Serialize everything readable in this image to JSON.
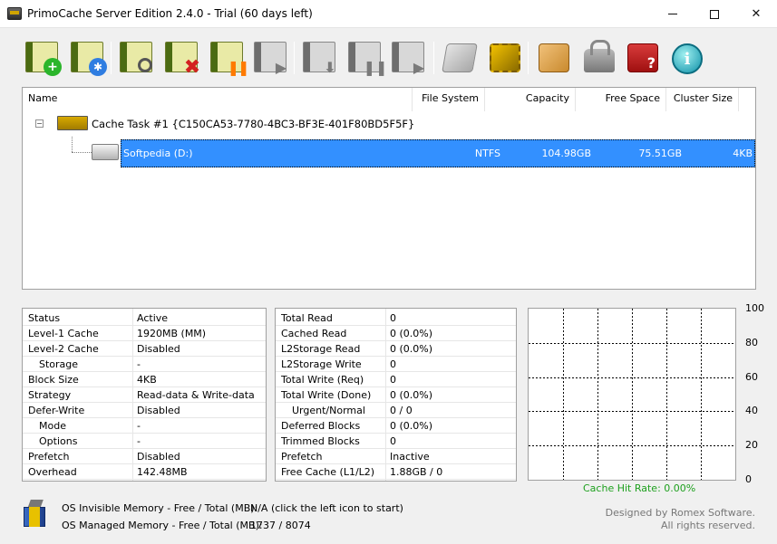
{
  "window": {
    "title": "PrimoCache Server Edition 2.4.0 - Trial (60 days left)",
    "minimize_label": "minimize",
    "maximize_label": "maximize",
    "close_label": "✕"
  },
  "toolbar": {
    "buttons": [
      {
        "name": "new-cache-task",
        "icon": "book-add-icon",
        "badge": "+"
      },
      {
        "name": "cache-task-settings",
        "icon": "book-gear-icon",
        "badge": "✱"
      },
      {
        "name": "cache-task-stats",
        "icon": "book-magnifier-icon",
        "badge": ""
      },
      {
        "name": "delete-cache-task",
        "icon": "book-delete-icon",
        "badge": "✖"
      },
      {
        "name": "pause-cache-task",
        "icon": "book-pause-icon",
        "badge": "❚❚"
      },
      {
        "name": "resume-cache-task",
        "icon": "book-play-icon",
        "badge": "▶"
      },
      {
        "name": "flush-volume",
        "icon": "book-flush-icon",
        "badge": "⬇"
      },
      {
        "name": "pause-volume",
        "icon": "book-pause-gray-icon",
        "badge": "❚❚"
      },
      {
        "name": "resume-volume",
        "icon": "book-play-gray-icon",
        "badge": "▶"
      },
      {
        "name": "storage-settings",
        "icon": "hdd-wrench-icon",
        "badge": ""
      },
      {
        "name": "memory-settings",
        "icon": "chip-wrench-icon",
        "badge": ""
      },
      {
        "name": "global-settings",
        "icon": "box-gear-icon",
        "badge": ""
      },
      {
        "name": "license",
        "icon": "lock-key-icon",
        "badge": ""
      },
      {
        "name": "help",
        "icon": "help-book-icon",
        "badge": ""
      },
      {
        "name": "about",
        "icon": "info-icon",
        "badge": "i"
      }
    ]
  },
  "list": {
    "columns": [
      "Name",
      "File System",
      "Capacity",
      "Free Space",
      "Cluster Size"
    ],
    "expander": "−",
    "task": {
      "label": "Cache Task #1 {C150CA53-7780-4BC3-BF3E-401F80BD5F5F}"
    },
    "volume": {
      "name": "Softpedia (D:)",
      "file_system": "NTFS",
      "capacity": "104.98GB",
      "free_space": "75.51GB",
      "cluster_size": "4KB"
    }
  },
  "status_grid": [
    {
      "label": "Status",
      "value": "Active"
    },
    {
      "label": "Level-1 Cache",
      "value": "1920MB (MM)"
    },
    {
      "label": "Level-2 Cache",
      "value": "Disabled"
    },
    {
      "label": "Storage",
      "value": "-",
      "indent": true
    },
    {
      "label": "Block Size",
      "value": "4KB"
    },
    {
      "label": "Strategy",
      "value": "Read-data & Write-data"
    },
    {
      "label": "Defer-Write",
      "value": "Disabled"
    },
    {
      "label": "Mode",
      "value": "-",
      "indent": true
    },
    {
      "label": "Options",
      "value": "-",
      "indent": true
    },
    {
      "label": "Prefetch",
      "value": "Disabled"
    },
    {
      "label": "Overhead",
      "value": "142.48MB"
    }
  ],
  "stats_grid": [
    {
      "label": "Total Read",
      "value": "0"
    },
    {
      "label": "Cached Read",
      "value": "0 (0.0%)"
    },
    {
      "label": "L2Storage Read",
      "value": "0 (0.0%)"
    },
    {
      "label": "L2Storage Write",
      "value": "0"
    },
    {
      "label": "Total Write (Req)",
      "value": "0"
    },
    {
      "label": "Total Write (Done)",
      "value": "0 (0.0%)"
    },
    {
      "label": "Urgent/Normal",
      "value": "0 / 0",
      "indent": true
    },
    {
      "label": "Deferred Blocks",
      "value": "0 (0.0%)"
    },
    {
      "label": "Trimmed Blocks",
      "value": "0"
    },
    {
      "label": "Prefetch",
      "value": "Inactive"
    },
    {
      "label": "Free Cache (L1/L2)",
      "value": "1.88GB / 0"
    }
  ],
  "chart_data": {
    "type": "line",
    "title": "",
    "caption": "Cache Hit Rate: 0.00%",
    "ylim": [
      0,
      100
    ],
    "yticks": [
      "100",
      "80",
      "60",
      "40",
      "20",
      "0"
    ],
    "grid": true,
    "series": [
      {
        "values": []
      }
    ]
  },
  "footer": {
    "invisible_label": "OS Invisible Memory - Free / Total (MB):",
    "invisible_value": "N/A (click the left icon to start)",
    "managed_label": "OS Managed Memory - Free / Total (MB):",
    "managed_value": "1737 / 8074",
    "credit_line1": "Designed by Romex Software.",
    "credit_line2": "All rights reserved."
  },
  "colors": {
    "selection": "#3390ff",
    "caption_green": "#1ea01e"
  }
}
